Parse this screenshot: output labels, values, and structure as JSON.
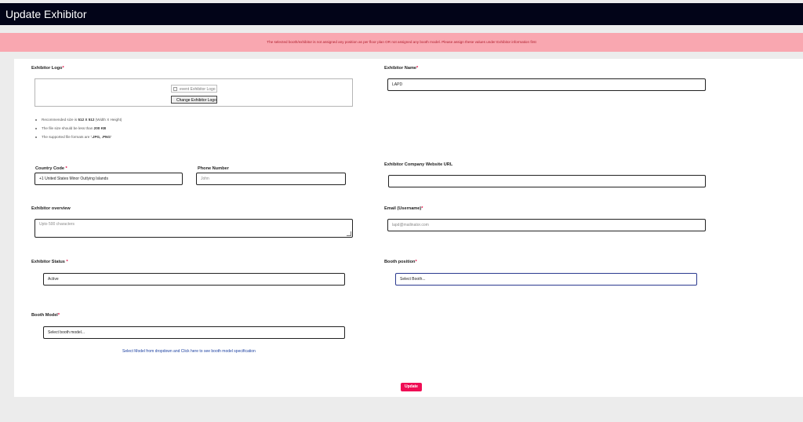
{
  "header": {
    "title": "Update Exhibitor"
  },
  "alert": {
    "message": "The selected booth/exhibitor is not assigned any position as per floor plan OR not assigned any booth model. Please assign these values under Exhibitor information first"
  },
  "form": {
    "logo": {
      "label": "Exhibitor Logo",
      "image_alt": "event Exhibitor Logo",
      "change_button": "Change Exhibitor Logo",
      "hints": [
        {
          "text": "Recommended size is ",
          "bold": "512 X 512",
          "suffix": " (Width X Height)"
        },
        {
          "text": "The file size should be less than ",
          "bold": "200 KB",
          "suffix": ""
        },
        {
          "text": "The supported file formats are ",
          "bold": "'.JPG, .PNG'",
          "suffix": ""
        }
      ]
    },
    "exhibitor_name": {
      "label": "Exhibitor Name",
      "value": "LAPD"
    },
    "country_code": {
      "label": "Country Code",
      "value": "+1 United States Minor Outlying Islands"
    },
    "phone_number": {
      "label": "Phone Number",
      "placeholder": "John"
    },
    "website_url": {
      "label": "Exhibitor Company Website URL",
      "value": ""
    },
    "overview": {
      "label": "Exhibitor overview",
      "placeholder": "Upto 500 characters"
    },
    "email": {
      "label": "Email (Username)",
      "value": "lapd@mailinator.com"
    },
    "status": {
      "label": "Exhibitor Status",
      "value": "Active"
    },
    "booth_position": {
      "label": "Booth position",
      "value": "Select Booth..."
    },
    "booth_model": {
      "label": "Booth Model",
      "value": "Select booth model...",
      "link_text": "Select Model from dropdown and Click here to see booth model specification"
    },
    "update_button": "Update"
  },
  "colors": {
    "header_bg": "#020418",
    "alert_bg": "#f9a7b0",
    "alert_text": "#b0202f",
    "required": "#e5003c",
    "primary_button": "#ef0e55",
    "link": "#1a3fa0"
  },
  "icons": {
    "broken_image": "broken-image-icon"
  }
}
